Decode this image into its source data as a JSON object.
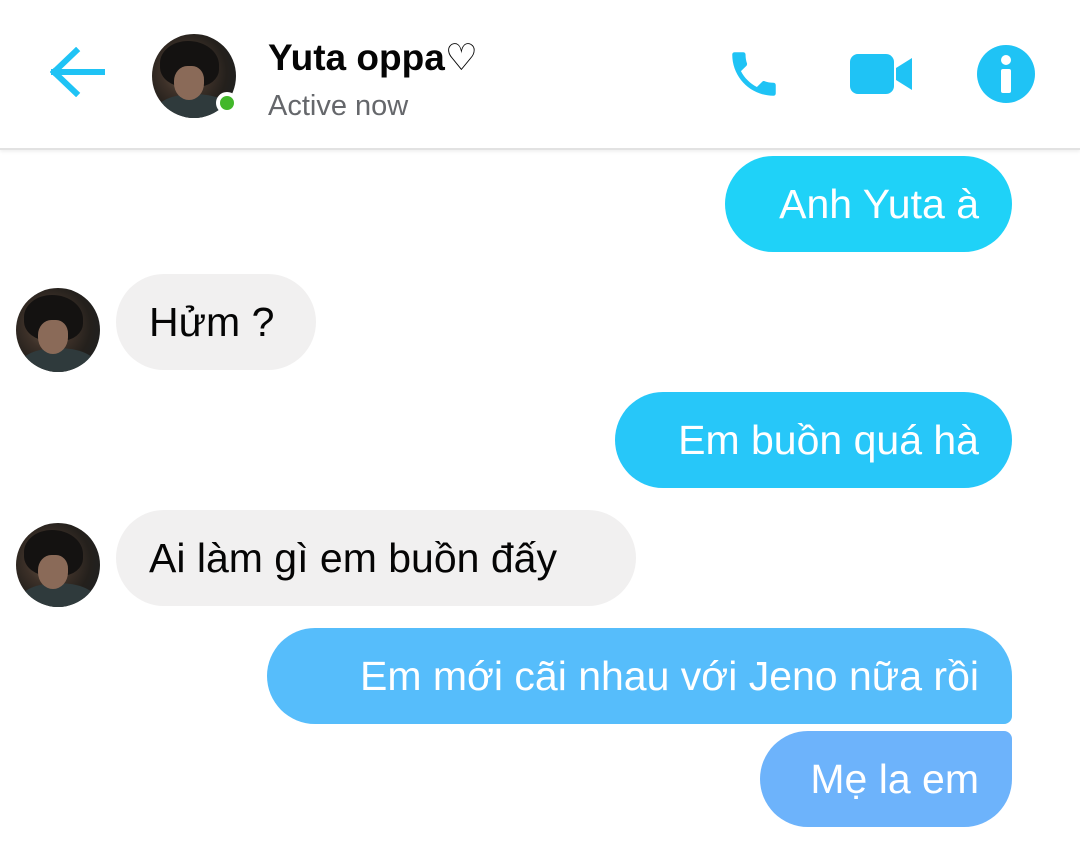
{
  "header": {
    "back_icon": "arrow-left-icon",
    "contact_name": "Yuta oppa♡",
    "status": "Active now",
    "call_icon": "phone-icon",
    "video_icon": "video-camera-icon",
    "info_icon": "info-icon",
    "accent_color": "#1fc3f5",
    "online_color": "#42b72a"
  },
  "messages": [
    {
      "direction": "sent",
      "text": "Anh Yuta à",
      "color": "#1fd2f8"
    },
    {
      "direction": "received",
      "text": "Hửm ?",
      "color": "#f1f0f0"
    },
    {
      "direction": "sent",
      "text": "Em buồn quá hà",
      "color": "#27c7f9"
    },
    {
      "direction": "received",
      "text": "Ai làm gì em buồn đấy",
      "color": "#f1f0f0"
    },
    {
      "direction": "sent",
      "text": "Em mới cãi nhau với Jeno nữa rồi",
      "color": "#56bdfb"
    },
    {
      "direction": "sent",
      "text": "Mẹ la em",
      "color": "#6db3fb"
    }
  ]
}
